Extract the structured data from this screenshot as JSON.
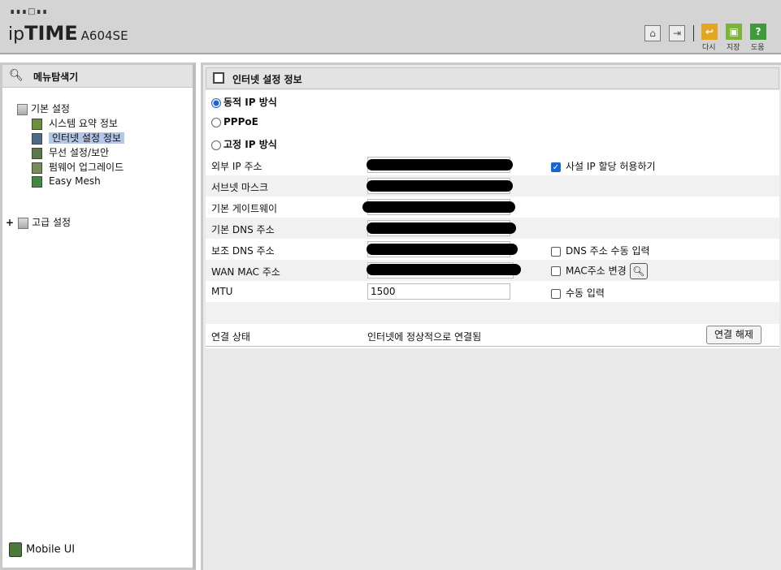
{
  "header": {
    "logo_dots": "∎∎∎□∎∎",
    "brand_prefix": "ip",
    "brand_main": "TIME",
    "model": "A604SE",
    "buttons": [
      {
        "name": "home-icon",
        "label": ""
      },
      {
        "name": "logout-icon",
        "label": ""
      },
      {
        "name": "refresh-icon",
        "label": "다시"
      },
      {
        "name": "save-icon",
        "label": "지장"
      },
      {
        "name": "help-icon",
        "label": "도움"
      }
    ]
  },
  "sidebar": {
    "title": "메뉴탐색기",
    "groups": [
      {
        "label": "기본 설정"
      },
      {
        "label": "고급 설정"
      }
    ],
    "items": [
      {
        "label": "시스템 요약 정보"
      },
      {
        "label": "인터넷 설정 정보"
      },
      {
        "label": "무선 설정/보안"
      },
      {
        "label": "펌웨어 업그레이드"
      },
      {
        "label": "Easy Mesh"
      }
    ],
    "mobile_label": "Mobile UI",
    "expand_glyph": "+"
  },
  "main": {
    "title": "인터넷 설정 정보",
    "radios": [
      {
        "label": "동적 IP 방식",
        "checked": true
      },
      {
        "label": "PPPoE",
        "checked": false
      },
      {
        "label": "고정 IP 방식",
        "checked": false
      }
    ],
    "fields": {
      "external_ip": "외부 IP 주소",
      "subnet": "서브넷 마스크",
      "gateway": "기본 게이트웨이",
      "dns1": "기본 DNS 주소",
      "dns2": "보조 DNS 주소",
      "wan_mac": "WAN MAC 주소",
      "mtu": "MTU",
      "status": "연결 상태"
    },
    "mtu_value": "1500",
    "checks": {
      "private_ip": {
        "label": "사설 IP 할당 허용하기",
        "checked": true
      },
      "dns_manual": {
        "label": "DNS 주소 수동 입력",
        "checked": false
      },
      "mac_change": {
        "label": "MAC주소 변경",
        "checked": false
      },
      "mtu_manual": {
        "label": "수동 입력",
        "checked": false
      }
    },
    "status_text": "인터넷에 정상적으로 연결됨",
    "disconnect_label": "연결 해제"
  }
}
